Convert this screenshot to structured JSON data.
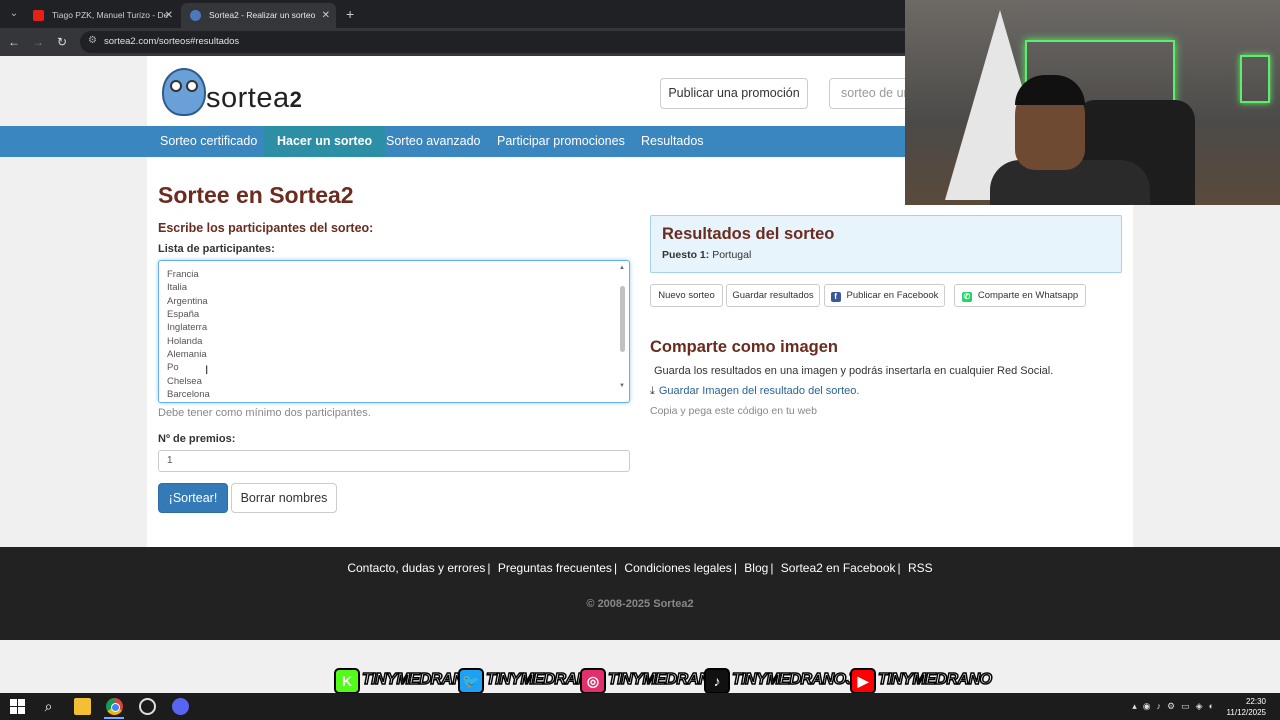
{
  "browser": {
    "tabs": [
      {
        "title": "Tiago PZK, Manuel Turizo - De"
      },
      {
        "title": "Sortea2 - Realizar un sorteo"
      }
    ],
    "new_tab": "+",
    "url": "sortea2.com/sorteos#resultados"
  },
  "header": {
    "logo_text": "sortea",
    "logo_num": "2",
    "publish_button": "Publicar una promoción",
    "search_placeholder": "sorteo de un"
  },
  "nav": {
    "items": [
      {
        "label": "Sorteo certificado"
      },
      {
        "label": "Hacer un sorteo"
      },
      {
        "label": "Sorteo avanzado"
      },
      {
        "label": "Participar promociones"
      },
      {
        "label": "Resultados"
      }
    ]
  },
  "form": {
    "title": "Sortee en Sortea2",
    "subtitle": "Escribe los participantes del sorteo:",
    "list_label": "Lista de participantes:",
    "participants": [
      "Francia",
      "Italia",
      "Argentina",
      "España",
      "Inglaterra",
      "Holanda",
      "Alemania",
      "Po",
      "Chelsea",
      "Barcelona"
    ],
    "help": "Debe tener como mínimo dos participantes.",
    "prizes_label": "Nº de premios:",
    "prizes_value": "1",
    "draw_button": "¡Sortear!",
    "clear_button": "Borrar nombres"
  },
  "results": {
    "heading": "Resultados del sorteo",
    "position_label": "Puesto 1:",
    "position_value": "Portugal",
    "buttons": {
      "new": "Nuevo sorteo",
      "save": "Guardar resultados",
      "facebook": "Publicar en Facebook",
      "whatsapp": "Comparte en Whatsapp"
    }
  },
  "share": {
    "heading": "Comparte como imagen",
    "text": "Guarda los resultados en una imagen y podrás insertarla en cualquier Red Social.",
    "link": "Guardar Imagen del resultado del sorteo.",
    "note": "Copia y pega este código en tu web"
  },
  "footer": {
    "links": [
      "Contacto, dudas y errores",
      "Preguntas frecuentes",
      "Condiciones legales",
      "Blog",
      "Sortea2 en Facebook",
      "RSS"
    ],
    "separator": "|",
    "copyright": "© 2008-2025 Sortea2"
  },
  "social_banner": [
    {
      "handle": "TINYMEDRANO",
      "icon": "kick-icon",
      "color": "#53fc18"
    },
    {
      "handle": "TINYMEDRANO",
      "icon": "twitter-icon",
      "color": "#1da1f2"
    },
    {
      "handle": "TINYMEDRANO",
      "icon": "instagram-icon",
      "color": "#e1306c"
    },
    {
      "handle": "TINYMEDRANOJR",
      "icon": "tiktok-icon",
      "color": "#111111"
    },
    {
      "handle": "TINYMEDRANO",
      "icon": "youtube-icon",
      "color": "#ff0000"
    }
  ],
  "taskbar": {
    "time": "22:30",
    "date": "11/12/2025"
  },
  "colors": {
    "nav_blue": "#3a86bf",
    "heading_brown": "#6b2b1f",
    "primary_button": "#337ab7"
  }
}
